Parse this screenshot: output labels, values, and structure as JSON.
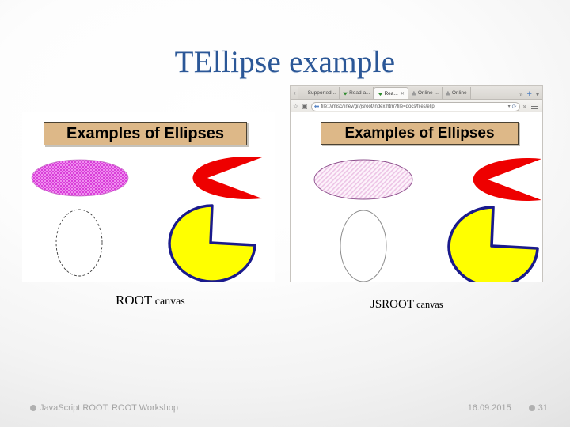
{
  "slide": {
    "title": "TEllipse example",
    "background_color": "#f1f1f1",
    "title_color": "#2b5797"
  },
  "browser": {
    "tab_nav_left_icon": "chevron-left-icon",
    "tabs": [
      {
        "label": "Supported...",
        "favicon": "green-arrow-icon",
        "active": false,
        "has_close": false
      },
      {
        "label": "Read a...",
        "favicon": "green-arrow-icon",
        "active": false,
        "has_close": false
      },
      {
        "label": "Rea...",
        "favicon": "green-arrow-icon",
        "active": true,
        "has_close": true
      },
      {
        "label": "Online ...",
        "favicon": "warning-icon",
        "active": false,
        "has_close": false
      },
      {
        "label": "Online",
        "favicon": "warning-icon",
        "active": false,
        "has_close": false
      }
    ],
    "tab_overflow_label": "»",
    "new_tab_label": "+",
    "tab_list_label": "▾",
    "toolbar": {
      "bookmark_icon": "star-icon",
      "screenshot_icon": "camera-icon",
      "back_icon": "back-arrow-icon",
      "url": "file:///misc/linev/git/jsroot/index.htm?file=docs/files/elip",
      "url_dropdown_label": "▾",
      "reload_label": "⟳",
      "overflow_label": "»",
      "menu_icon": "hamburger-menu-icon"
    }
  },
  "root_canvas": {
    "title": "Examples of Ellipses",
    "title_box_fill": "#ddb888",
    "title_box_border": "#4a4132",
    "shapes": {
      "hatched_ellipse": {
        "name": "magenta-hatched-ellipse",
        "fill": "#e45ce4",
        "pattern": "cross-hatch"
      },
      "pacman": {
        "name": "red-pacman-ellipse",
        "fill": "#ee0000"
      },
      "outline_ellipse": {
        "name": "dashed-outline-ellipse",
        "stroke": "#333333",
        "fill": "none"
      },
      "pie": {
        "name": "yellow-pie-ellipse",
        "fill": "#ffff00",
        "stroke": "#1a1a8c"
      }
    }
  },
  "jsroot_canvas": {
    "title": "Examples of Ellipses",
    "title_box_fill": "#ddb888",
    "title_box_border": "#4a4132",
    "shapes": {
      "hatched_ellipse": {
        "name": "pink-hatched-ellipse",
        "fill": "#f3d4ee",
        "pattern": "diagonal-hatch",
        "stroke": "#8c4f8c"
      },
      "pacman": {
        "name": "red-pacman-ellipse",
        "fill": "#ee0000"
      },
      "outline_ellipse": {
        "name": "outline-ellipse",
        "stroke": "#888888",
        "fill": "none"
      },
      "pie": {
        "name": "yellow-pie-ellipse",
        "fill": "#ffff00",
        "stroke": "#1a1a8c"
      }
    }
  },
  "captions": {
    "root": {
      "main": "ROOT",
      "suffix": " canvas"
    },
    "jsroot": {
      "main": "JSROOT",
      "suffix": " canvas"
    }
  },
  "footer": {
    "left_text": "JavaScript ROOT, ROOT Workshop",
    "date": "16.09.2015",
    "slide_number": "31",
    "bullet_color": "#b0b0b0",
    "text_color": "#a3a3a3"
  }
}
